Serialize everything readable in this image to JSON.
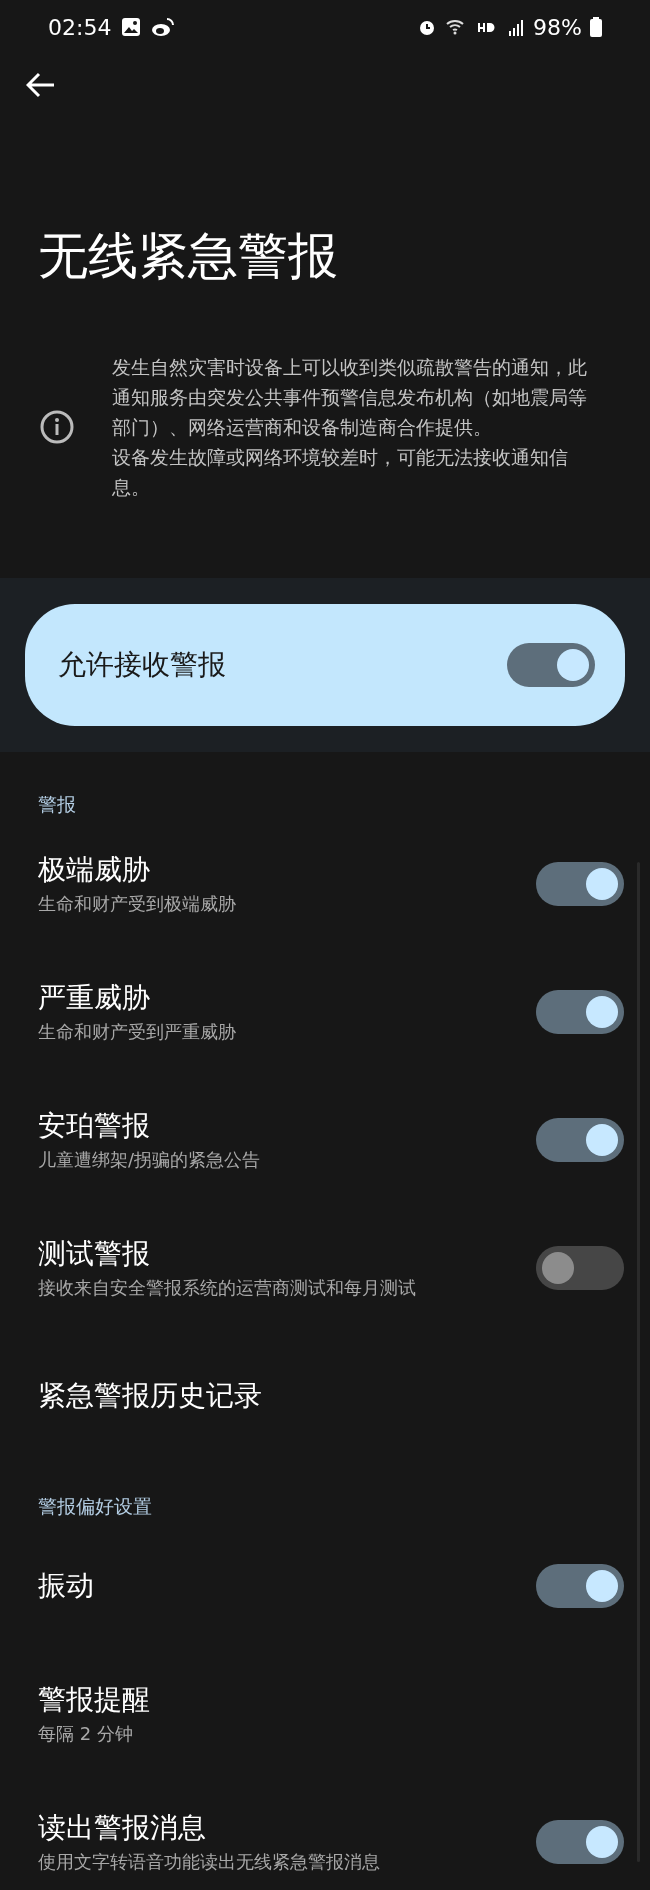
{
  "status_bar": {
    "time": "02:54",
    "battery": "98%"
  },
  "title": "无线紧急警报",
  "info": [
    "发生自然灾害时设备上可以收到类似疏散警告的通知，此通知服务由突发公共事件预警信息发布机构（如地震局等部门）、网络运营商和设备制造商合作提供。",
    "设备发生故障或网络环境较差时，可能无法接收通知信息。"
  ],
  "master": {
    "label": "允许接收警报",
    "on": true
  },
  "sections": [
    {
      "header": "警报",
      "items": [
        {
          "title": "极端威胁",
          "subtitle": "生命和财产受到极端威胁",
          "kind": "switch",
          "on": true
        },
        {
          "title": "严重威胁",
          "subtitle": "生命和财产受到严重威胁",
          "kind": "switch",
          "on": true
        },
        {
          "title": "安珀警报",
          "subtitle": "儿童遭绑架/拐骗的紧急公告",
          "kind": "switch",
          "on": true
        },
        {
          "title": "测试警报",
          "subtitle": "接收来自安全警报系统的运营商测试和每月测试",
          "kind": "switch",
          "on": false
        },
        {
          "title": "紧急警报历史记录",
          "kind": "link"
        }
      ]
    },
    {
      "header": "警报偏好设置",
      "items": [
        {
          "title": "振动",
          "kind": "switch",
          "on": true
        },
        {
          "title": "警报提醒",
          "subtitle": "每隔 2 分钟",
          "kind": "link"
        },
        {
          "title": "读出警报消息",
          "subtitle": "使用文字转语音功能读出无线紧急警报消息",
          "kind": "switch",
          "on": true
        }
      ]
    }
  ]
}
